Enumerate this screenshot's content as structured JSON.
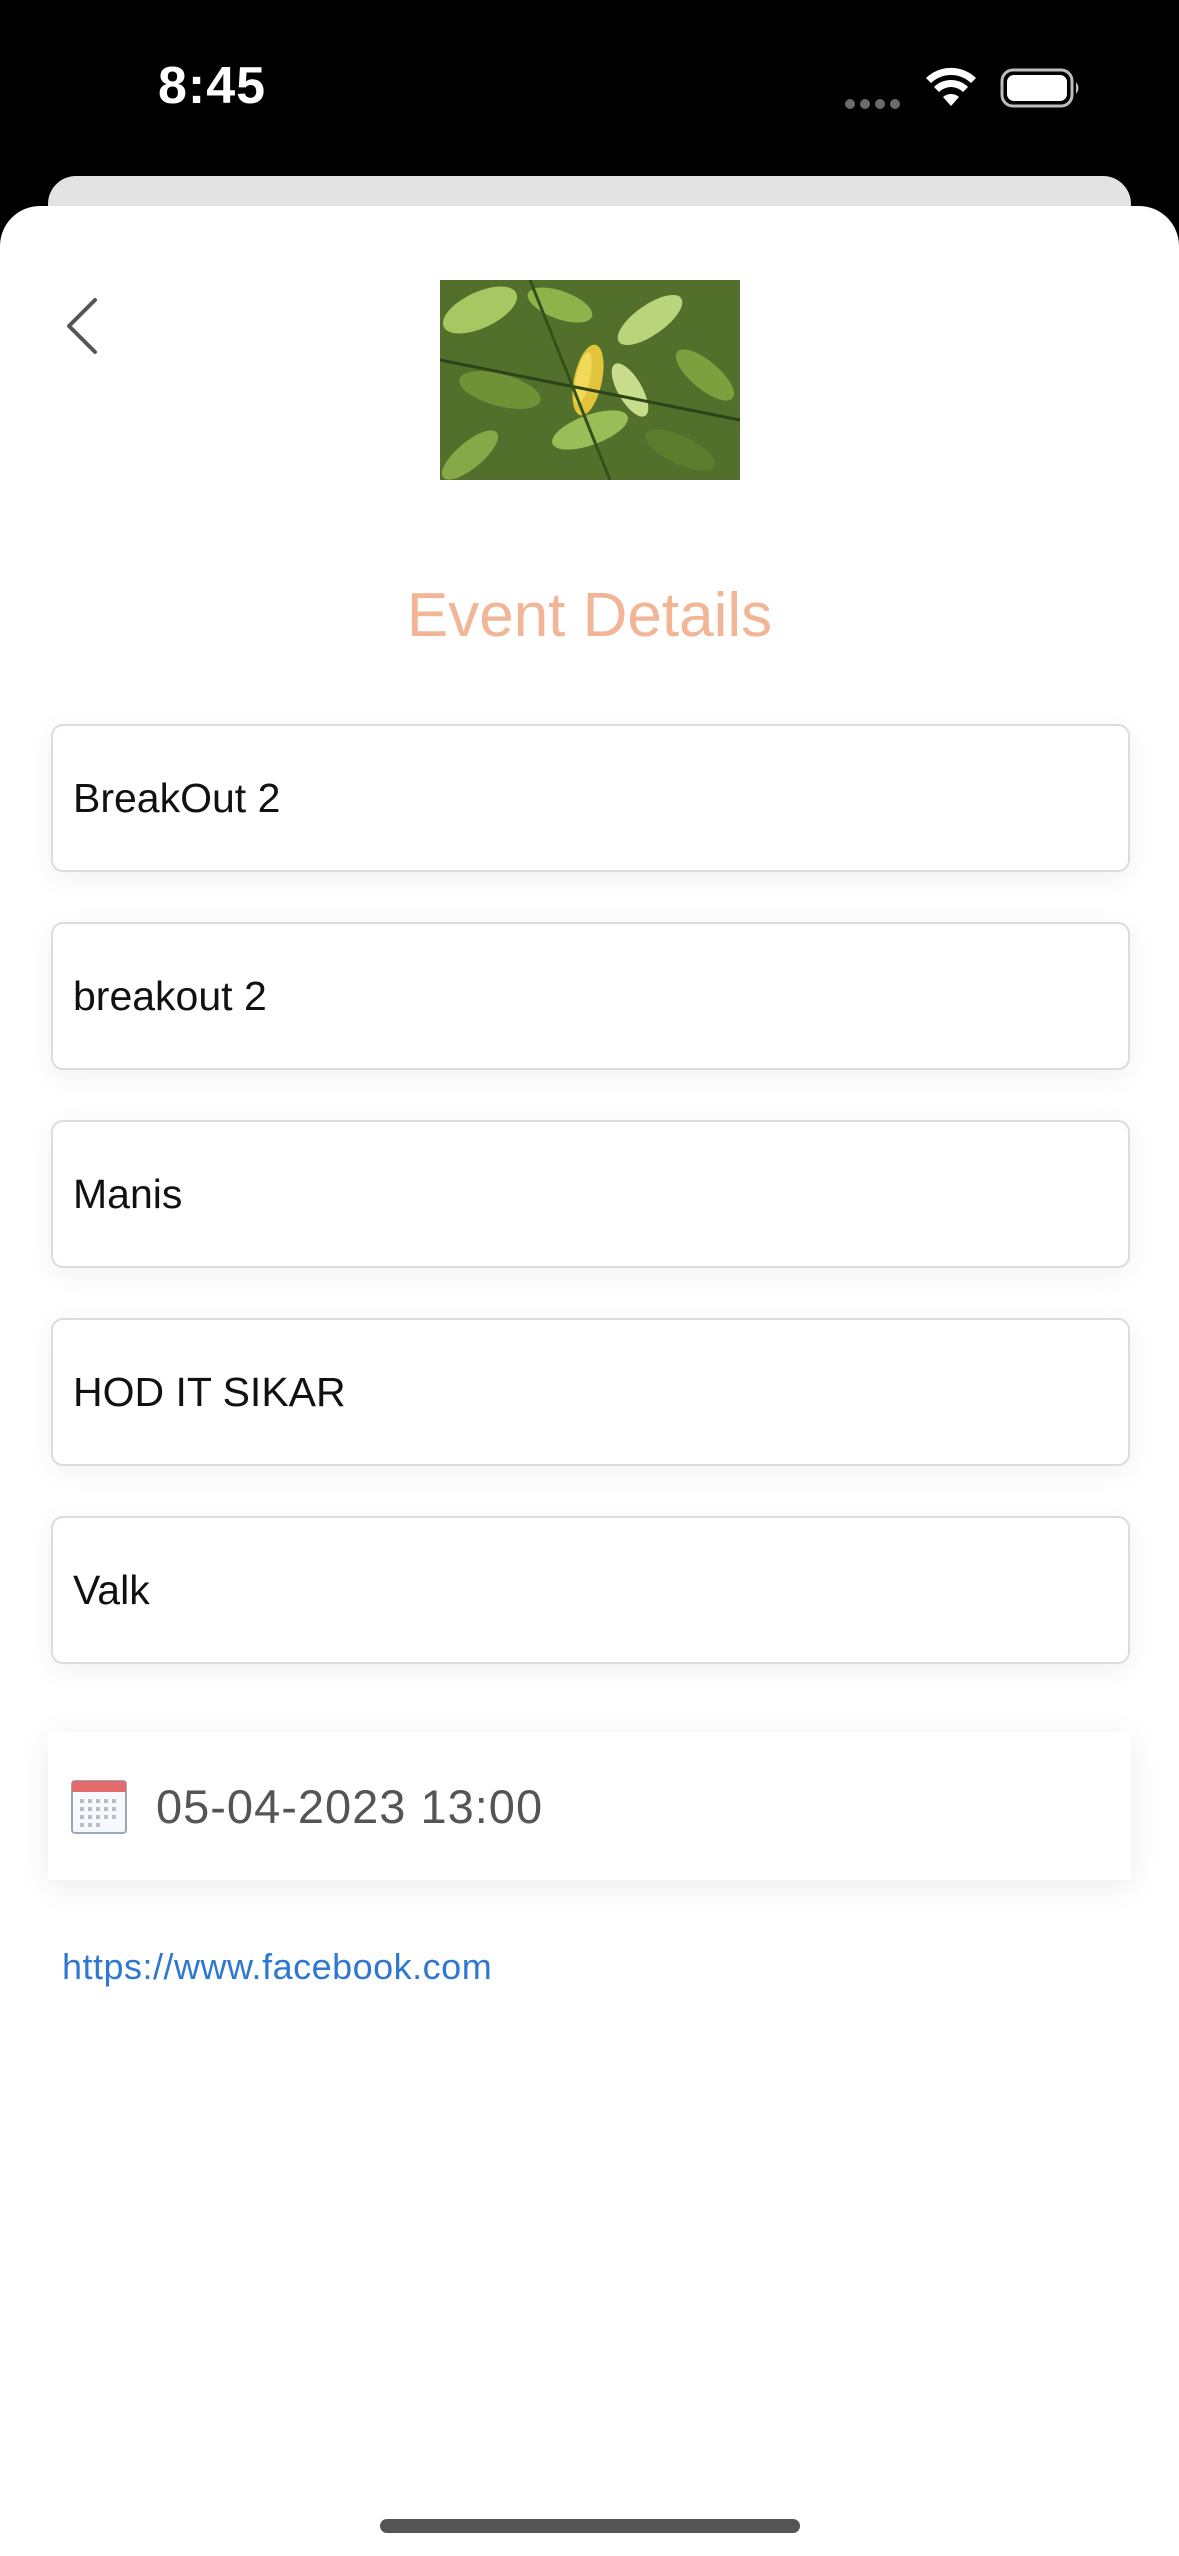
{
  "status_bar": {
    "time": "8:45"
  },
  "header": {
    "title": "Event Details"
  },
  "fields": [
    {
      "value": "BreakOut 2"
    },
    {
      "value": "breakout 2"
    },
    {
      "value": "Manis"
    },
    {
      "value": "HOD IT SIKAR"
    },
    {
      "value": "Valk"
    }
  ],
  "date": {
    "value": "05-04-2023 13:00"
  },
  "link": {
    "text": "https://www.facebook.com"
  },
  "colors": {
    "title": "#f2b596",
    "link": "#2f78d2",
    "calendar_accent": "#e46b6b"
  }
}
